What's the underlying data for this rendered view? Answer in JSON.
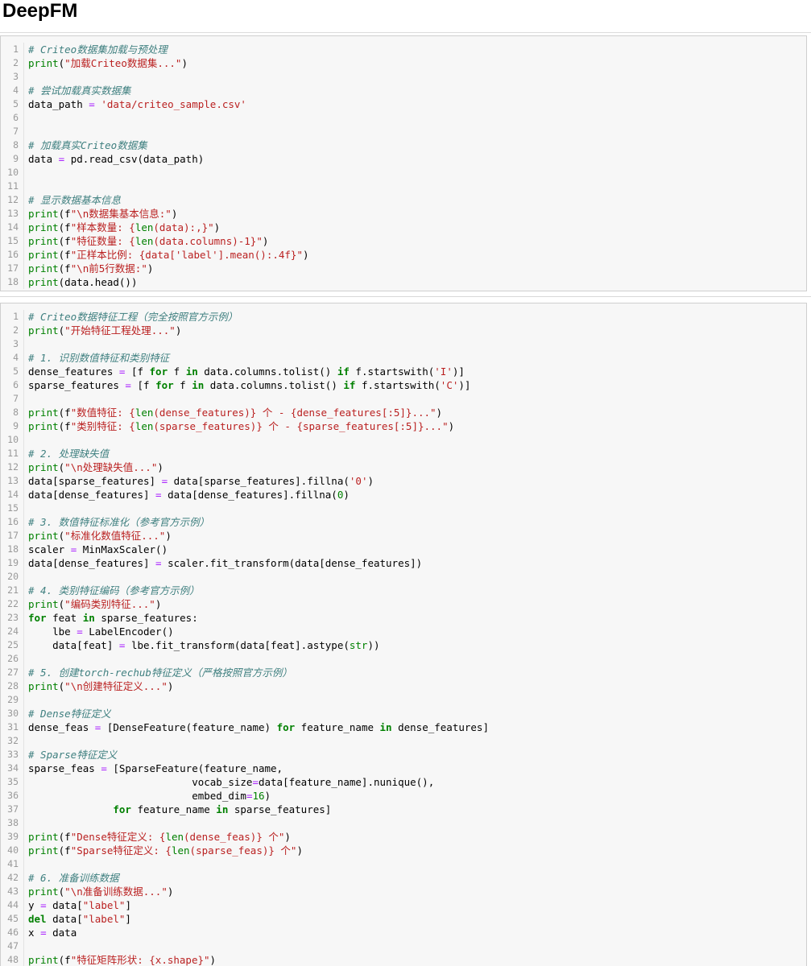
{
  "notebook": {
    "title": "DeepFM"
  },
  "cells": [
    {
      "lines": [
        [
          [
            "c",
            "# Criteo数据集加载与预处理"
          ]
        ],
        [
          [
            "n",
            "print"
          ],
          [
            "p",
            "("
          ],
          [
            "s",
            "\"加载Criteo数据集...\""
          ],
          [
            "p",
            ")"
          ]
        ],
        [],
        [
          [
            "c",
            "# 尝试加载真实数据集"
          ]
        ],
        [
          [
            "p",
            "data_path "
          ],
          [
            "o",
            "="
          ],
          [
            "p",
            " "
          ],
          [
            "s",
            "'data/criteo_sample.csv'"
          ]
        ],
        [],
        [],
        [
          [
            "c",
            "# 加载真实Criteo数据集"
          ]
        ],
        [
          [
            "p",
            "data "
          ],
          [
            "o",
            "="
          ],
          [
            "p",
            " pd.read_csv(data_path)"
          ]
        ],
        [],
        [],
        [
          [
            "c",
            "# 显示数据基本信息"
          ]
        ],
        [
          [
            "n",
            "print"
          ],
          [
            "p",
            "(f"
          ],
          [
            "s",
            "\"\\n数据集基本信息:\""
          ],
          [
            "p",
            ")"
          ]
        ],
        [
          [
            "n",
            "print"
          ],
          [
            "p",
            "(f"
          ],
          [
            "s",
            "\"样本数量: {"
          ],
          [
            "n",
            "len"
          ],
          [
            "s",
            "(data):,}\""
          ],
          [
            "p",
            ")"
          ]
        ],
        [
          [
            "n",
            "print"
          ],
          [
            "p",
            "(f"
          ],
          [
            "s",
            "\"特征数量: {"
          ],
          [
            "n",
            "len"
          ],
          [
            "s",
            "(data.columns)-1}\""
          ],
          [
            "p",
            ")"
          ]
        ],
        [
          [
            "n",
            "print"
          ],
          [
            "p",
            "(f"
          ],
          [
            "s",
            "\"正样本比例: {data['label'].mean():.4f}\""
          ],
          [
            "p",
            ")"
          ]
        ],
        [
          [
            "n",
            "print"
          ],
          [
            "p",
            "(f"
          ],
          [
            "s",
            "\"\\n前5行数据:\""
          ],
          [
            "p",
            ")"
          ]
        ],
        [
          [
            "n",
            "print"
          ],
          [
            "p",
            "(data.head())"
          ]
        ]
      ]
    },
    {
      "lines": [
        [
          [
            "c",
            "# Criteo数据特征工程（完全按照官方示例）"
          ]
        ],
        [
          [
            "n",
            "print"
          ],
          [
            "p",
            "("
          ],
          [
            "s",
            "\"开始特征工程处理...\""
          ],
          [
            "p",
            ")"
          ]
        ],
        [],
        [
          [
            "c",
            "# 1. 识别数值特征和类别特征"
          ]
        ],
        [
          [
            "p",
            "dense_features "
          ],
          [
            "o",
            "="
          ],
          [
            "p",
            " [f "
          ],
          [
            "k",
            "for"
          ],
          [
            "p",
            " f "
          ],
          [
            "k",
            "in"
          ],
          [
            "p",
            " data.columns.tolist() "
          ],
          [
            "k",
            "if"
          ],
          [
            "p",
            " f.startswith("
          ],
          [
            "s",
            "'I'"
          ],
          [
            "p",
            ")]"
          ]
        ],
        [
          [
            "p",
            "sparse_features "
          ],
          [
            "o",
            "="
          ],
          [
            "p",
            " [f "
          ],
          [
            "k",
            "for"
          ],
          [
            "p",
            " f "
          ],
          [
            "k",
            "in"
          ],
          [
            "p",
            " data.columns.tolist() "
          ],
          [
            "k",
            "if"
          ],
          [
            "p",
            " f.startswith("
          ],
          [
            "s",
            "'C'"
          ],
          [
            "p",
            ")]"
          ]
        ],
        [],
        [
          [
            "n",
            "print"
          ],
          [
            "p",
            "(f"
          ],
          [
            "s",
            "\"数值特征: {"
          ],
          [
            "n",
            "len"
          ],
          [
            "s",
            "(dense_features)} 个 - {dense_features[:5]}...\""
          ],
          [
            "p",
            ")"
          ]
        ],
        [
          [
            "n",
            "print"
          ],
          [
            "p",
            "(f"
          ],
          [
            "s",
            "\"类别特征: {"
          ],
          [
            "n",
            "len"
          ],
          [
            "s",
            "(sparse_features)} 个 - {sparse_features[:5]}...\""
          ],
          [
            "p",
            ")"
          ]
        ],
        [],
        [
          [
            "c",
            "# 2. 处理缺失值"
          ]
        ],
        [
          [
            "n",
            "print"
          ],
          [
            "p",
            "("
          ],
          [
            "s",
            "\"\\n处理缺失值...\""
          ],
          [
            "p",
            ")"
          ]
        ],
        [
          [
            "p",
            "data[sparse_features] "
          ],
          [
            "o",
            "="
          ],
          [
            "p",
            " data[sparse_features].fillna("
          ],
          [
            "s",
            "'0'"
          ],
          [
            "p",
            ")"
          ]
        ],
        [
          [
            "p",
            "data[dense_features] "
          ],
          [
            "o",
            "="
          ],
          [
            "p",
            " data[dense_features].fillna("
          ],
          [
            "n",
            "0"
          ],
          [
            "p",
            ")"
          ]
        ],
        [],
        [
          [
            "c",
            "# 3. 数值特征标准化（参考官方示例）"
          ]
        ],
        [
          [
            "n",
            "print"
          ],
          [
            "p",
            "("
          ],
          [
            "s",
            "\"标准化数值特征...\""
          ],
          [
            "p",
            ")"
          ]
        ],
        [
          [
            "p",
            "scaler "
          ],
          [
            "o",
            "="
          ],
          [
            "p",
            " MinMaxScaler()"
          ]
        ],
        [
          [
            "p",
            "data[dense_features] "
          ],
          [
            "o",
            "="
          ],
          [
            "p",
            " scaler.fit_transform(data[dense_features])"
          ]
        ],
        [],
        [
          [
            "c",
            "# 4. 类别特征编码（参考官方示例）"
          ]
        ],
        [
          [
            "n",
            "print"
          ],
          [
            "p",
            "("
          ],
          [
            "s",
            "\"编码类别特征...\""
          ],
          [
            "p",
            ")"
          ]
        ],
        [
          [
            "k",
            "for"
          ],
          [
            "p",
            " feat "
          ],
          [
            "k",
            "in"
          ],
          [
            "p",
            " sparse_features:"
          ]
        ],
        [
          [
            "p",
            "    lbe "
          ],
          [
            "o",
            "="
          ],
          [
            "p",
            " LabelEncoder()"
          ]
        ],
        [
          [
            "p",
            "    data[feat] "
          ],
          [
            "o",
            "="
          ],
          [
            "p",
            " lbe.fit_transform(data[feat].astype("
          ],
          [
            "n",
            "str"
          ],
          [
            "p",
            "))"
          ]
        ],
        [],
        [
          [
            "c",
            "# 5. 创建torch-rechub特征定义（严格按照官方示例）"
          ]
        ],
        [
          [
            "n",
            "print"
          ],
          [
            "p",
            "("
          ],
          [
            "s",
            "\"\\n创建特征定义...\""
          ],
          [
            "p",
            ")"
          ]
        ],
        [],
        [
          [
            "c",
            "# Dense特征定义"
          ]
        ],
        [
          [
            "p",
            "dense_feas "
          ],
          [
            "o",
            "="
          ],
          [
            "p",
            " [DenseFeature(feature_name) "
          ],
          [
            "k",
            "for"
          ],
          [
            "p",
            " feature_name "
          ],
          [
            "k",
            "in"
          ],
          [
            "p",
            " dense_features]"
          ]
        ],
        [],
        [
          [
            "c",
            "# Sparse特征定义"
          ]
        ],
        [
          [
            "p",
            "sparse_feas "
          ],
          [
            "o",
            "="
          ],
          [
            "p",
            " [SparseFeature(feature_name,"
          ]
        ],
        [
          [
            "p",
            "                           vocab_size"
          ],
          [
            "o",
            "="
          ],
          [
            "p",
            "data[feature_name].nunique(),"
          ]
        ],
        [
          [
            "p",
            "                           embed_dim"
          ],
          [
            "o",
            "="
          ],
          [
            "n",
            "16"
          ],
          [
            "p",
            ")"
          ]
        ],
        [
          [
            "p",
            "              "
          ],
          [
            "k",
            "for"
          ],
          [
            "p",
            " feature_name "
          ],
          [
            "k",
            "in"
          ],
          [
            "p",
            " sparse_features]"
          ]
        ],
        [],
        [
          [
            "n",
            "print"
          ],
          [
            "p",
            "(f"
          ],
          [
            "s",
            "\"Dense特征定义: {"
          ],
          [
            "n",
            "len"
          ],
          [
            "s",
            "(dense_feas)} 个\""
          ],
          [
            "p",
            ")"
          ]
        ],
        [
          [
            "n",
            "print"
          ],
          [
            "p",
            "(f"
          ],
          [
            "s",
            "\"Sparse特征定义: {"
          ],
          [
            "n",
            "len"
          ],
          [
            "s",
            "(sparse_feas)} 个\""
          ],
          [
            "p",
            ")"
          ]
        ],
        [],
        [
          [
            "c",
            "# 6. 准备训练数据"
          ]
        ],
        [
          [
            "n",
            "print"
          ],
          [
            "p",
            "("
          ],
          [
            "s",
            "\"\\n准备训练数据...\""
          ],
          [
            "p",
            ")"
          ]
        ],
        [
          [
            "p",
            "y "
          ],
          [
            "o",
            "="
          ],
          [
            "p",
            " data["
          ],
          [
            "s",
            "\"label\""
          ],
          [
            "p",
            "]"
          ]
        ],
        [
          [
            "k",
            "del"
          ],
          [
            "p",
            " data["
          ],
          [
            "s",
            "\"label\""
          ],
          [
            "p",
            "]"
          ]
        ],
        [
          [
            "p",
            "x "
          ],
          [
            "o",
            "="
          ],
          [
            "p",
            " data"
          ]
        ],
        [],
        [
          [
            "n",
            "print"
          ],
          [
            "p",
            "(f"
          ],
          [
            "s",
            "\"特征矩阵形状: {x.shape}\""
          ],
          [
            "p",
            ")"
          ]
        ]
      ]
    }
  ]
}
